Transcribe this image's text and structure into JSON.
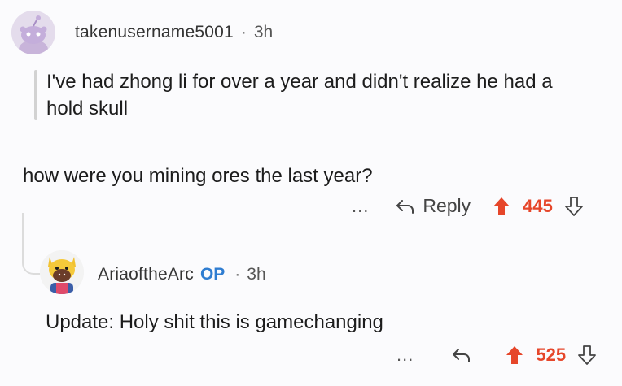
{
  "comment1": {
    "username": "takenusername5001",
    "separator": "·",
    "time": "3h",
    "quote": "I've had zhong li for over a year and didn't realize he had a hold skull",
    "body": "how were you mining ores the last year?",
    "more": "...",
    "reply_label": "Reply",
    "score": "445"
  },
  "comment2": {
    "username": "AriaoftheArc",
    "op_badge": "OP",
    "separator": "·",
    "time": "3h",
    "body": "Update: Holy shit this is gamechanging",
    "more": "...",
    "score": "525"
  },
  "colors": {
    "upvote": "#e6462a",
    "op": "#2f7dd1"
  }
}
